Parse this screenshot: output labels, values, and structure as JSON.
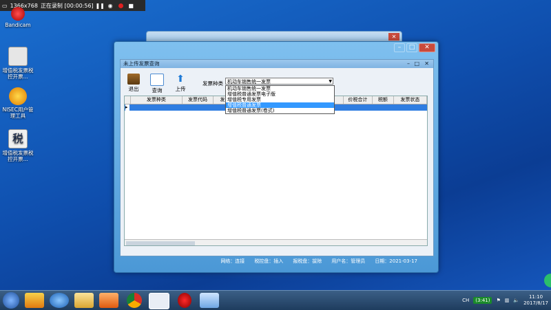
{
  "recorder": {
    "resolution": "1366x768",
    "status": "正在录制 [00:00:56]"
  },
  "desktop_icons": [
    {
      "label": "Bandicam"
    },
    {
      "label": "增值税发票税控开票..."
    },
    {
      "label": "NISEC用户管理工具"
    },
    {
      "label": "增值税发票税控开票..."
    }
  ],
  "window": {
    "title": "未上传发票查询",
    "toolbar": [
      {
        "label": "退出"
      },
      {
        "label": "查询"
      },
      {
        "label": "上传"
      }
    ],
    "filter": {
      "label": "发票种类",
      "selected": "机动车销售统一发票",
      "options": [
        "机动车销售统一发票",
        "增值税普通发票电子版",
        "增值税专用发票",
        "增值税普通发票",
        "增值税普通发票(卷式)"
      ],
      "highlighted_index": 3
    },
    "columns": [
      "发票种类",
      "发票代码",
      "发票号",
      "",
      "",
      "",
      "价税合计",
      "税额",
      "发票状态"
    ],
    "statusbar": [
      "网络：连接",
      "税控盘：插入",
      "报税盘：拔除",
      "用户名：管理员",
      "日期：2021-03-17"
    ]
  },
  "taskbar": {
    "ime": "(3:41)",
    "lang": "CH",
    "time": "11:10",
    "date": "2017/8/17"
  },
  "colors": {
    "accent": "#2f7de1",
    "selected_item": "#3399ff"
  }
}
